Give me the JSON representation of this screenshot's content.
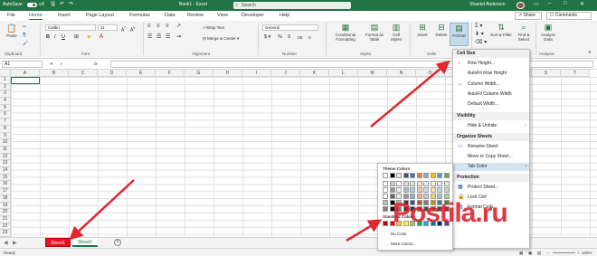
{
  "titlebar": {
    "autosave": "AutoSave",
    "autosave_state": "Off",
    "book_title": "Book1 - Excel",
    "search_placeholder": "Search",
    "user_name": "Shantel Anderson",
    "accent": "#217346"
  },
  "tabs": [
    "File",
    "Home",
    "Insert",
    "Page Layout",
    "Formulas",
    "Data",
    "Review",
    "View",
    "Developer",
    "Help"
  ],
  "active_tab": "Home",
  "share_label": "Share",
  "comments_label": "Comments",
  "ribbon": {
    "paste_label": "Paste",
    "font_name": "Calibri",
    "font_size": "11",
    "wrap_text": "Wrap Text",
    "merge_center": "Merge & Center",
    "number_format": "General",
    "cond_format": "Conditional Formatting",
    "format_table": "Format as Table",
    "cell_styles": "Cell Styles",
    "insert": "Insert",
    "delete": "Delete",
    "format": "Format",
    "sort_filter": "Sort & Filter",
    "find_select": "Find & Select",
    "analyze_data": "Analyze Data",
    "groups": {
      "clipboard": "Clipboard",
      "font": "Font",
      "alignment": "Alignment",
      "number": "Number",
      "styles": "Styles",
      "cells": "Cells",
      "editing": "Editing",
      "analysis": "Analysis"
    }
  },
  "formula_bar": {
    "name_box": "A1",
    "fx": "fx"
  },
  "grid": {
    "columns": [
      "A",
      "B",
      "C",
      "D",
      "E",
      "F",
      "G",
      "H",
      "I",
      "J",
      "K",
      "L",
      "M",
      "N",
      "O",
      "P",
      "Q",
      "R",
      "S",
      "T"
    ],
    "rows": [
      "1",
      "2",
      "3",
      "4",
      "5",
      "6",
      "7",
      "8",
      "9",
      "10",
      "11",
      "12",
      "13",
      "14",
      "15",
      "16",
      "17",
      "18",
      "19",
      "20",
      "21",
      "22",
      "23"
    ]
  },
  "sheets": {
    "tabs": [
      "Sheet1",
      "Sheet2"
    ],
    "add": "+",
    "nav_prev": "◀",
    "nav_next": "▶",
    "sheet1_color": "#e81123"
  },
  "status": {
    "ready": "Ready",
    "zoom": "100%"
  },
  "format_menu": {
    "cell_size": "Cell Size",
    "row_height": "Row Height...",
    "autofit_row": "AutoFit Row Height",
    "col_width": "Column Width...",
    "autofit_col": "AutoFit Column Width",
    "default_width": "Default Width...",
    "visibility": "Visibility",
    "hide_unhide": "Hide & Unhide",
    "organize": "Organize Sheets",
    "rename": "Rename Sheet",
    "move_copy": "Move or Copy Sheet...",
    "tab_color": "Tab Color",
    "protection": "Protection",
    "protect_sheet": "Protect Sheet...",
    "lock_cell": "Lock Cell",
    "format_cells": "Format Cells..."
  },
  "tab_color_menu": {
    "theme_colors": "Theme Colors",
    "standard_colors": "Standard Colors",
    "no_color": "No Color",
    "more_colors": "More Colors...",
    "theme_top": [
      "#ffffff",
      "#000000",
      "#e7e6e6",
      "#44546a",
      "#4472c4",
      "#ed7d31",
      "#a5a5a5",
      "#ffc000",
      "#5b9bd5",
      "#70ad47"
    ],
    "standard": [
      "#c00000",
      "#ff0000",
      "#ffc000",
      "#ffff00",
      "#92d050",
      "#00b050",
      "#00b0f0",
      "#0070c0",
      "#002060",
      "#7030a0"
    ]
  },
  "watermark": "Postila.ru"
}
